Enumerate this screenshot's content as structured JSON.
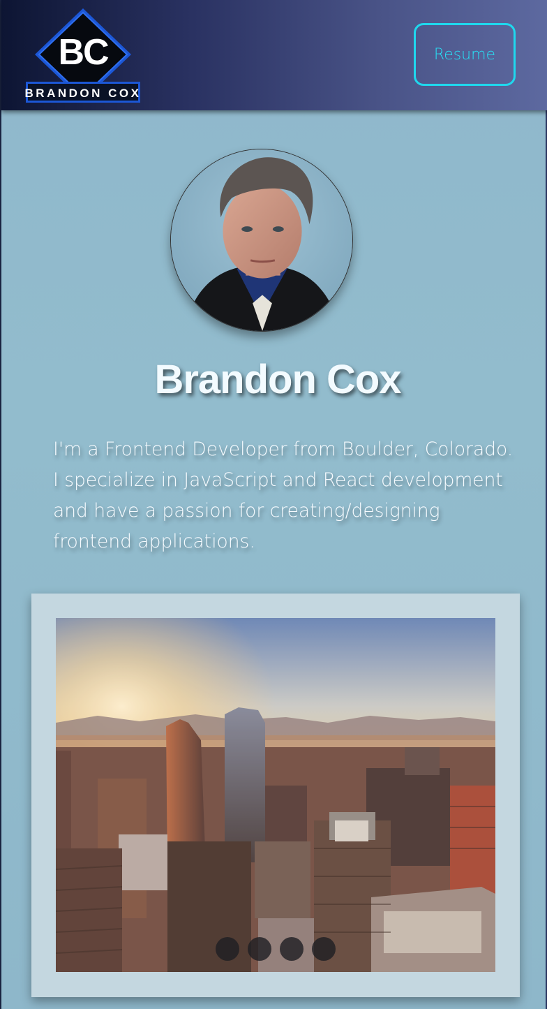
{
  "header": {
    "logo_initials": "BC",
    "logo_name": "BRANDON COX",
    "resume_label": "Resume"
  },
  "profile": {
    "name": "Brandon Cox",
    "bio": "I'm a Frontend Developer from Boulder, Colorado. I specialize in JavaScript and React development and have a passion for creating/designing frontend applications."
  },
  "carousel": {
    "dot_count": 4,
    "active_index": 0
  },
  "colors": {
    "accent": "#1fd8ee",
    "header_dark": "#0d1533",
    "header_light": "#5d69a0",
    "page_background": "#8fb7cb",
    "card_background": "#c4d7e0"
  },
  "icons": [
    "logo-diamond-icon"
  ]
}
